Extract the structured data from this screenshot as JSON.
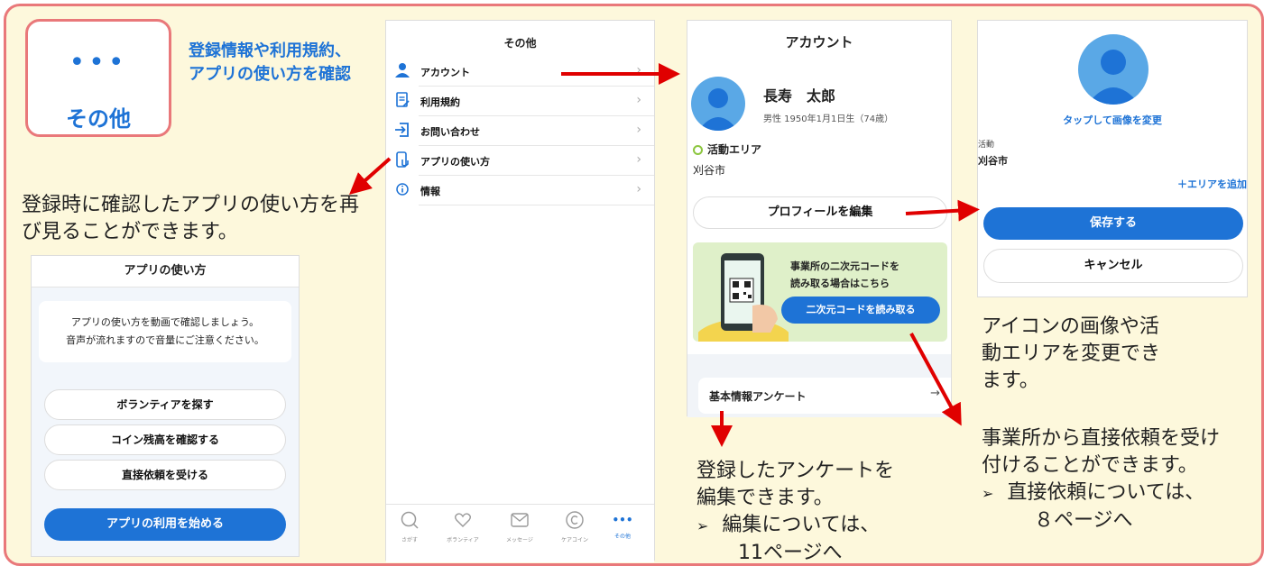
{
  "other_icon": {
    "dots": "•••",
    "label": "その他",
    "caption": "登録情報や利用規約、アプリの使い方を確認"
  },
  "note_howto": "登録時に確認したアプリの使い方を再び見ることができます。",
  "howto_screen": {
    "title": "アプリの使い方",
    "message_line1": "アプリの使い方を動画で確認しましょう。",
    "message_line2": "音声が流れますので音量にご注意ください。",
    "buttons": [
      "ボランティアを探す",
      "コイン残高を確認する",
      "直接依頼を受ける"
    ],
    "start": "アプリの利用を始める"
  },
  "other_screen": {
    "title": "その他",
    "items": [
      {
        "label": "アカウント",
        "icon": "person-icon"
      },
      {
        "label": "利用規約",
        "icon": "document-icon"
      },
      {
        "label": "お問い合わせ",
        "icon": "arrow-in-icon"
      },
      {
        "label": "アプリの使い方",
        "icon": "phone-hand-icon"
      },
      {
        "label": "情報",
        "icon": "info-icon"
      }
    ],
    "tabs": [
      {
        "label": "さがす",
        "icon": "search-icon"
      },
      {
        "label": "ボランティア",
        "icon": "heart-hand-icon"
      },
      {
        "label": "メッセージ",
        "icon": "mail-icon"
      },
      {
        "label": "ケアコイン",
        "icon": "coin-icon"
      },
      {
        "label": "その他",
        "icon": "more-icon",
        "glyph": "•••"
      }
    ]
  },
  "account_screen": {
    "title": "アカウント",
    "name": "長寿　太郎",
    "details": "男性  1950年1月1日生（74歳）",
    "area_label": "活動エリア",
    "area_value": "刈谷市",
    "edit_button": "プロフィールを編集",
    "qr_text_line1": "事業所の二次元コードを",
    "qr_text_line2": "読み取る場合はこちら",
    "qr_button": "二次元コードを読み取る",
    "survey": "基本情報アンケート",
    "survey_arrow": "→"
  },
  "edit_screen": {
    "change_image": "タップして画像を変更",
    "area_label": "活動",
    "area_value": "刈谷市",
    "add_area": "＋エリアを追加",
    "save": "保存する",
    "cancel": "キャンセル"
  },
  "note_edit": "アイコンの画像や活動エリアを変更できます。",
  "note_survey": {
    "line1": "登録したアンケートを",
    "line2": "編集できます。",
    "bullet1": "編集については、",
    "bullet2": "11ページへ"
  },
  "note_direct": {
    "line1": "事業所から直接依頼を受け",
    "line2": "付けることができます。",
    "bullet1": "直接依頼については、",
    "bullet2": "８ページへ"
  },
  "colors": {
    "frame_border": "#e9787a",
    "background": "#fdf8dc",
    "accent_blue": "#1e73d6",
    "arrow_red": "#e00000"
  }
}
